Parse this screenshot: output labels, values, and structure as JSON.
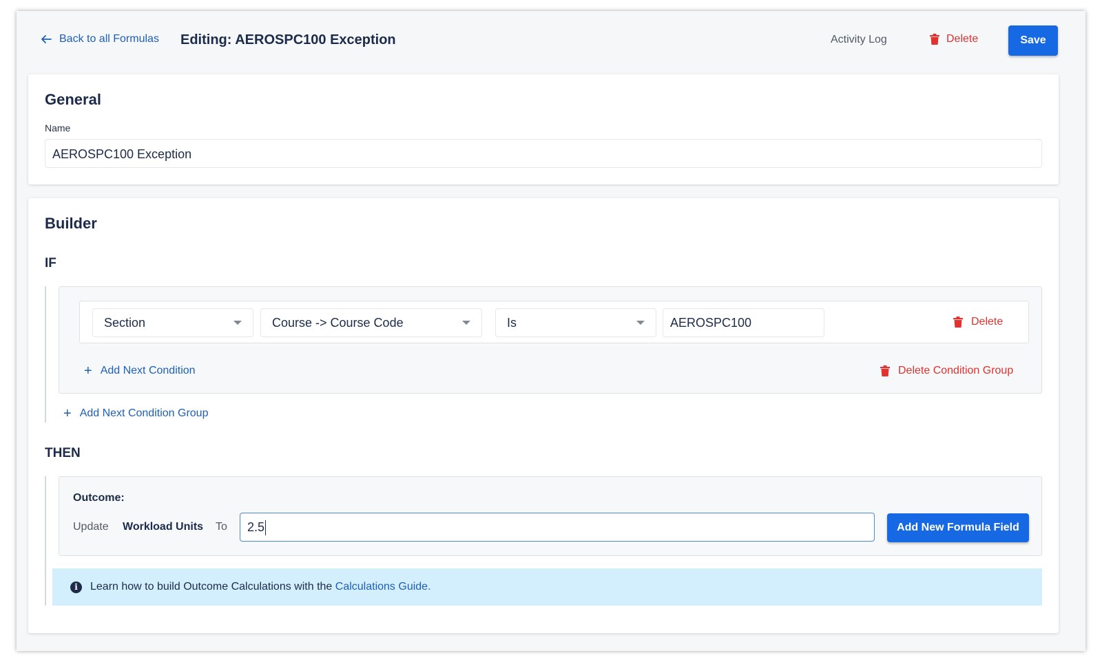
{
  "header": {
    "back_label": "Back to all Formulas",
    "title": "Editing: AEROSPC100 Exception",
    "activity_label": "Activity Log",
    "delete_label": "Delete",
    "save_label": "Save"
  },
  "general": {
    "heading": "General",
    "name_label": "Name",
    "name_value": "AEROSPC100 Exception"
  },
  "builder": {
    "heading": "Builder",
    "if_label": "IF",
    "condition": {
      "field1": "Section",
      "field2": "Course -> Course Code",
      "operator": "Is",
      "value": "AEROSPC100",
      "delete_label": "Delete"
    },
    "add_condition_label": "Add Next Condition",
    "delete_group_label": "Delete Condition Group",
    "add_group_label": "Add Next Condition Group",
    "then_label": "THEN",
    "outcome": {
      "label": "Outcome:",
      "update_word": "Update",
      "field": "Workload Units",
      "to_word": "To",
      "value": "2.5",
      "add_formula_label": "Add New Formula Field"
    },
    "info": {
      "text": "Learn how to build Outcome Calculations with the",
      "link": "Calculations Guide."
    }
  },
  "colors": {
    "accent": "#1668e3",
    "danger": "#e0332f",
    "link": "#1d5fb8",
    "info_bg": "#d3eefc"
  }
}
